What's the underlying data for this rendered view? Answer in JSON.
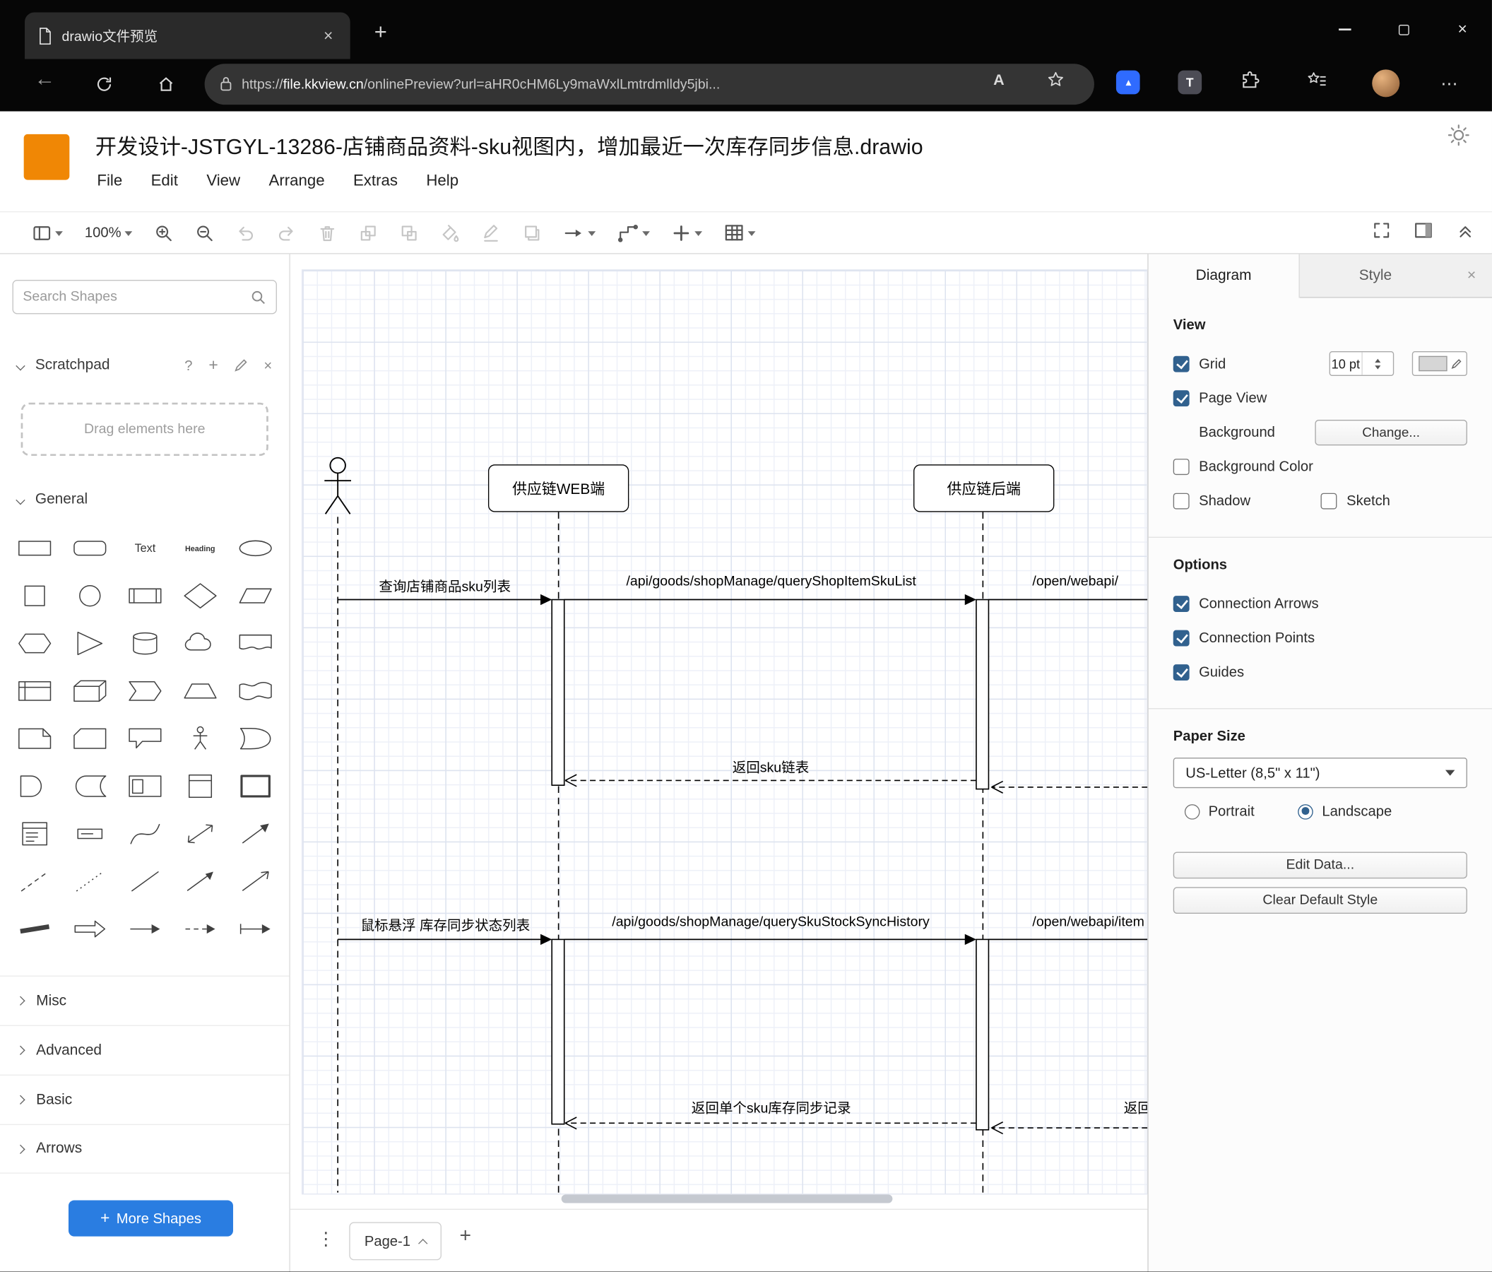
{
  "icons": {
    "close": "×",
    "plus": "+",
    "kebab": "⋮",
    "ellipsis": "⋯",
    "help": "?",
    "back": "←",
    "read_aloud": "A",
    "tamper": "T"
  },
  "browser": {
    "tab_title": "drawio文件预览",
    "address": {
      "scheme": "https://",
      "host": "file.kkview.cn",
      "path": "/onlinePreview?url=aHR0cHM6Ly9maWxlLmtrdmlldy5jbi..."
    }
  },
  "app": {
    "title": "开发设计-JSTGYL-13286-店铺商品资料-sku视图内，增加最近一次库存同步信息.drawio",
    "menu": [
      "File",
      "Edit",
      "View",
      "Arrange",
      "Extras",
      "Help"
    ],
    "zoom": "100%"
  },
  "sidebar": {
    "search_placeholder": "Search Shapes",
    "scratchpad": {
      "title": "Scratchpad",
      "hint": "Drag elements here"
    },
    "sections": {
      "general": "General",
      "misc": "Misc",
      "advanced": "Advanced",
      "basic": "Basic",
      "arrows": "Arrows"
    },
    "shape_labels": {
      "text": "Text",
      "heading": "Heading"
    },
    "more_shapes": "More Shapes"
  },
  "diagram": {
    "lifelines": [
      "供应链WEB端",
      "供应链后端"
    ],
    "messages": {
      "m1": "查询店铺商品sku列表",
      "m2": "/api/goods/shopManage/queryShopItemSkuList",
      "m3": "/open/webapi/",
      "r1": "返回sku链表",
      "m4": "鼠标悬浮 库存同步状态列表",
      "m5": "/api/goods/shopManage/querySkuStockSyncHistory",
      "m6": "/open/webapi/item",
      "r2": "返回单个sku库存同步记录",
      "r3": "返回"
    }
  },
  "footer": {
    "page_tab": "Page-1"
  },
  "panel": {
    "tabs": {
      "diagram": "Diagram",
      "style": "Style"
    },
    "view": {
      "heading": "View",
      "grid": "Grid",
      "grid_size": "10 pt",
      "page_view": "Page View",
      "background": "Background",
      "change": "Change...",
      "background_color": "Background Color",
      "shadow": "Shadow",
      "sketch": "Sketch"
    },
    "options": {
      "heading": "Options",
      "connection_arrows": "Connection Arrows",
      "connection_points": "Connection Points",
      "guides": "Guides"
    },
    "paper": {
      "heading": "Paper Size",
      "size": "US-Letter (8,5\" x 11\")",
      "portrait": "Portrait",
      "landscape": "Landscape"
    },
    "buttons": {
      "edit_data": "Edit Data...",
      "clear_default_style": "Clear Default Style"
    }
  }
}
